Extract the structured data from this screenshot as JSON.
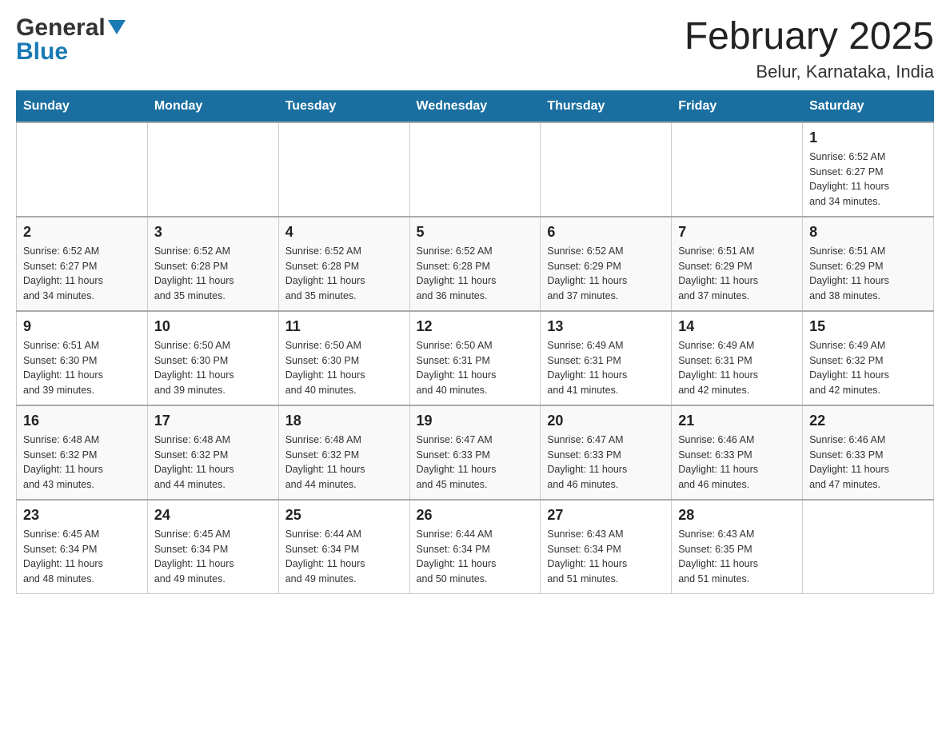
{
  "header": {
    "logo_general": "General",
    "logo_blue": "Blue",
    "month_title": "February 2025",
    "location": "Belur, Karnataka, India"
  },
  "calendar": {
    "days_of_week": [
      "Sunday",
      "Monday",
      "Tuesday",
      "Wednesday",
      "Thursday",
      "Friday",
      "Saturday"
    ],
    "weeks": [
      {
        "days": [
          {
            "date": "",
            "info": ""
          },
          {
            "date": "",
            "info": ""
          },
          {
            "date": "",
            "info": ""
          },
          {
            "date": "",
            "info": ""
          },
          {
            "date": "",
            "info": ""
          },
          {
            "date": "",
            "info": ""
          },
          {
            "date": "1",
            "info": "Sunrise: 6:52 AM\nSunset: 6:27 PM\nDaylight: 11 hours\nand 34 minutes."
          }
        ]
      },
      {
        "days": [
          {
            "date": "2",
            "info": "Sunrise: 6:52 AM\nSunset: 6:27 PM\nDaylight: 11 hours\nand 34 minutes."
          },
          {
            "date": "3",
            "info": "Sunrise: 6:52 AM\nSunset: 6:28 PM\nDaylight: 11 hours\nand 35 minutes."
          },
          {
            "date": "4",
            "info": "Sunrise: 6:52 AM\nSunset: 6:28 PM\nDaylight: 11 hours\nand 35 minutes."
          },
          {
            "date": "5",
            "info": "Sunrise: 6:52 AM\nSunset: 6:28 PM\nDaylight: 11 hours\nand 36 minutes."
          },
          {
            "date": "6",
            "info": "Sunrise: 6:52 AM\nSunset: 6:29 PM\nDaylight: 11 hours\nand 37 minutes."
          },
          {
            "date": "7",
            "info": "Sunrise: 6:51 AM\nSunset: 6:29 PM\nDaylight: 11 hours\nand 37 minutes."
          },
          {
            "date": "8",
            "info": "Sunrise: 6:51 AM\nSunset: 6:29 PM\nDaylight: 11 hours\nand 38 minutes."
          }
        ]
      },
      {
        "days": [
          {
            "date": "9",
            "info": "Sunrise: 6:51 AM\nSunset: 6:30 PM\nDaylight: 11 hours\nand 39 minutes."
          },
          {
            "date": "10",
            "info": "Sunrise: 6:50 AM\nSunset: 6:30 PM\nDaylight: 11 hours\nand 39 minutes."
          },
          {
            "date": "11",
            "info": "Sunrise: 6:50 AM\nSunset: 6:30 PM\nDaylight: 11 hours\nand 40 minutes."
          },
          {
            "date": "12",
            "info": "Sunrise: 6:50 AM\nSunset: 6:31 PM\nDaylight: 11 hours\nand 40 minutes."
          },
          {
            "date": "13",
            "info": "Sunrise: 6:49 AM\nSunset: 6:31 PM\nDaylight: 11 hours\nand 41 minutes."
          },
          {
            "date": "14",
            "info": "Sunrise: 6:49 AM\nSunset: 6:31 PM\nDaylight: 11 hours\nand 42 minutes."
          },
          {
            "date": "15",
            "info": "Sunrise: 6:49 AM\nSunset: 6:32 PM\nDaylight: 11 hours\nand 42 minutes."
          }
        ]
      },
      {
        "days": [
          {
            "date": "16",
            "info": "Sunrise: 6:48 AM\nSunset: 6:32 PM\nDaylight: 11 hours\nand 43 minutes."
          },
          {
            "date": "17",
            "info": "Sunrise: 6:48 AM\nSunset: 6:32 PM\nDaylight: 11 hours\nand 44 minutes."
          },
          {
            "date": "18",
            "info": "Sunrise: 6:48 AM\nSunset: 6:32 PM\nDaylight: 11 hours\nand 44 minutes."
          },
          {
            "date": "19",
            "info": "Sunrise: 6:47 AM\nSunset: 6:33 PM\nDaylight: 11 hours\nand 45 minutes."
          },
          {
            "date": "20",
            "info": "Sunrise: 6:47 AM\nSunset: 6:33 PM\nDaylight: 11 hours\nand 46 minutes."
          },
          {
            "date": "21",
            "info": "Sunrise: 6:46 AM\nSunset: 6:33 PM\nDaylight: 11 hours\nand 46 minutes."
          },
          {
            "date": "22",
            "info": "Sunrise: 6:46 AM\nSunset: 6:33 PM\nDaylight: 11 hours\nand 47 minutes."
          }
        ]
      },
      {
        "days": [
          {
            "date": "23",
            "info": "Sunrise: 6:45 AM\nSunset: 6:34 PM\nDaylight: 11 hours\nand 48 minutes."
          },
          {
            "date": "24",
            "info": "Sunrise: 6:45 AM\nSunset: 6:34 PM\nDaylight: 11 hours\nand 49 minutes."
          },
          {
            "date": "25",
            "info": "Sunrise: 6:44 AM\nSunset: 6:34 PM\nDaylight: 11 hours\nand 49 minutes."
          },
          {
            "date": "26",
            "info": "Sunrise: 6:44 AM\nSunset: 6:34 PM\nDaylight: 11 hours\nand 50 minutes."
          },
          {
            "date": "27",
            "info": "Sunrise: 6:43 AM\nSunset: 6:34 PM\nDaylight: 11 hours\nand 51 minutes."
          },
          {
            "date": "28",
            "info": "Sunrise: 6:43 AM\nSunset: 6:35 PM\nDaylight: 11 hours\nand 51 minutes."
          },
          {
            "date": "",
            "info": ""
          }
        ]
      }
    ]
  }
}
